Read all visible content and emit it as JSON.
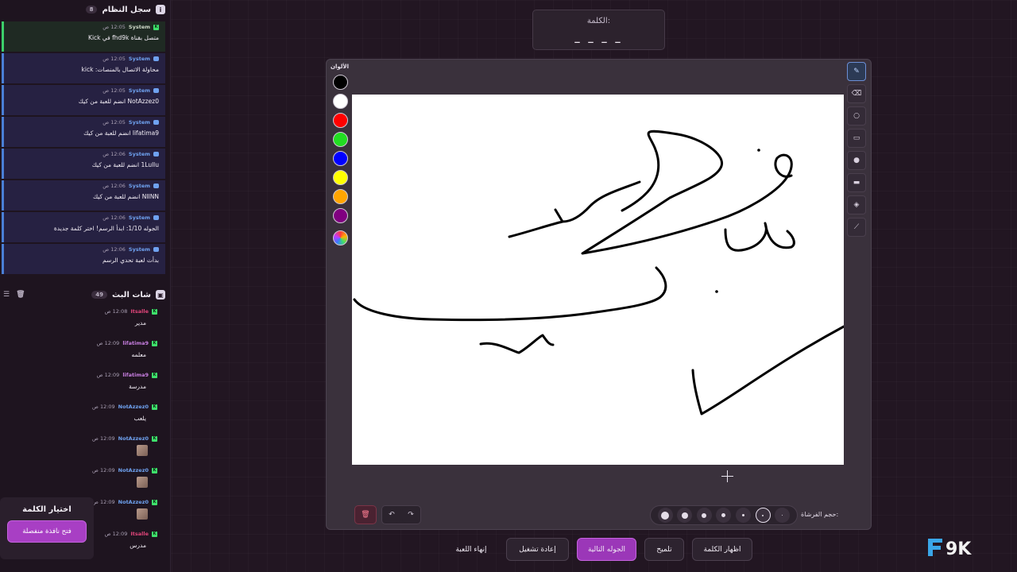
{
  "syslog": {
    "title": "سجل النظام",
    "count": "8",
    "items": [
      {
        "sender": "System",
        "time": "12:05 ص",
        "text": "متصل بقناة fhd9k في Kick"
      },
      {
        "sender": "System",
        "time": "12:05 ص",
        "text": "محاولة الاتصال بالمنصات: kick"
      },
      {
        "sender": "System",
        "time": "12:05 ص",
        "text": "NotAzzez0 انضم للعبة من كيك"
      },
      {
        "sender": "System",
        "time": "12:05 ص",
        "text": "lifatima9 انضم للعبة من كيك"
      },
      {
        "sender": "System",
        "time": "12:06 ص",
        "text": "1Lullu انضم للعبة من كيك"
      },
      {
        "sender": "System",
        "time": "12:06 ص",
        "text": "NIINN انضم للعبة من كيك"
      },
      {
        "sender": "System",
        "time": "12:06 ص",
        "text": "الجوله 1/10: ابدأ الرسم! اختر كلمة جديدة"
      },
      {
        "sender": "System",
        "time": "12:06 ص",
        "text": "بدأت لعبة تحدي الرسم"
      }
    ]
  },
  "chat": {
    "title": "شات البث",
    "count": "49",
    "items": [
      {
        "user": "Itsalle",
        "time": "12:08 ص",
        "text": "مدير",
        "color": "#e0457a",
        "emote": false
      },
      {
        "user": "lifatima9",
        "time": "12:09 ص",
        "text": "معلمه",
        "color": "#c77ee0",
        "emote": false
      },
      {
        "user": "lifatima9",
        "time": "12:09 ص",
        "text": "مدرسة",
        "color": "#c77ee0",
        "emote": false
      },
      {
        "user": "NotAzzez0",
        "time": "12:09 ص",
        "text": "يلعب",
        "color": "#6fa2f0",
        "emote": false
      },
      {
        "user": "NotAzzez0",
        "time": "12:09 ص",
        "text": "",
        "color": "#6fa2f0",
        "emote": true
      },
      {
        "user": "NotAzzez0",
        "time": "12:09 ص",
        "text": "",
        "color": "#6fa2f0",
        "emote": true
      },
      {
        "user": "NotAzzez0",
        "time": "12:09 ص",
        "text": "",
        "color": "#6fa2f0",
        "emote": true
      },
      {
        "user": "Itsalle",
        "time": "12:09 ص",
        "text": "مدرس",
        "color": "#e0457a",
        "emote": false
      }
    ]
  },
  "choose_word": {
    "title": "اختيار الكلمة",
    "button": "فتح نافذة منفصلة"
  },
  "word": {
    "label": "الكلمة:",
    "blanks": "_ _ _ _"
  },
  "board": {
    "colors_title": "الألوان",
    "colors": [
      "#000000",
      "#ffffff",
      "#ff0000",
      "#22dd22",
      "#0000ff",
      "#ffff00",
      "#ffa500",
      "#800080"
    ],
    "brush_label": "حجم الفرشاة:",
    "selected_brush_index": 1
  },
  "tools": [
    "pencil-icon",
    "eraser-icon",
    "circle-icon",
    "rectangle-icon",
    "filled-circle-icon",
    "filled-rect-icon",
    "fill-bucket-icon",
    "line-icon"
  ],
  "actions": {
    "show_word": "اظهار الكلمة",
    "hint": "تلميح",
    "next_round": "الجوله التالية",
    "restart": "إعادة تشغيل",
    "end_game": "إنهاء اللعبة"
  },
  "logo": {
    "text": "F9K"
  }
}
